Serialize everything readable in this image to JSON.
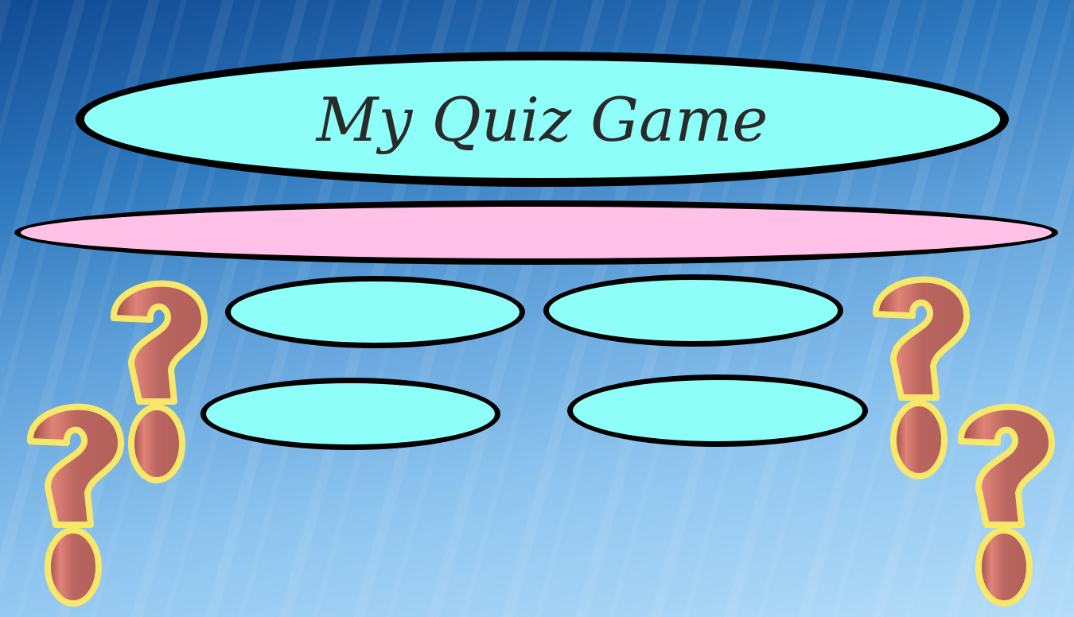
{
  "title": "My Quiz Game",
  "question": "",
  "answers": [
    "",
    "",
    "",
    ""
  ],
  "colors": {
    "title_fill": "#8efef8",
    "question_fill": "#ffc1e8",
    "answer_fill": "#8efef8",
    "qmark": "#b9655f",
    "qmark_outline": "#f8e86a"
  }
}
